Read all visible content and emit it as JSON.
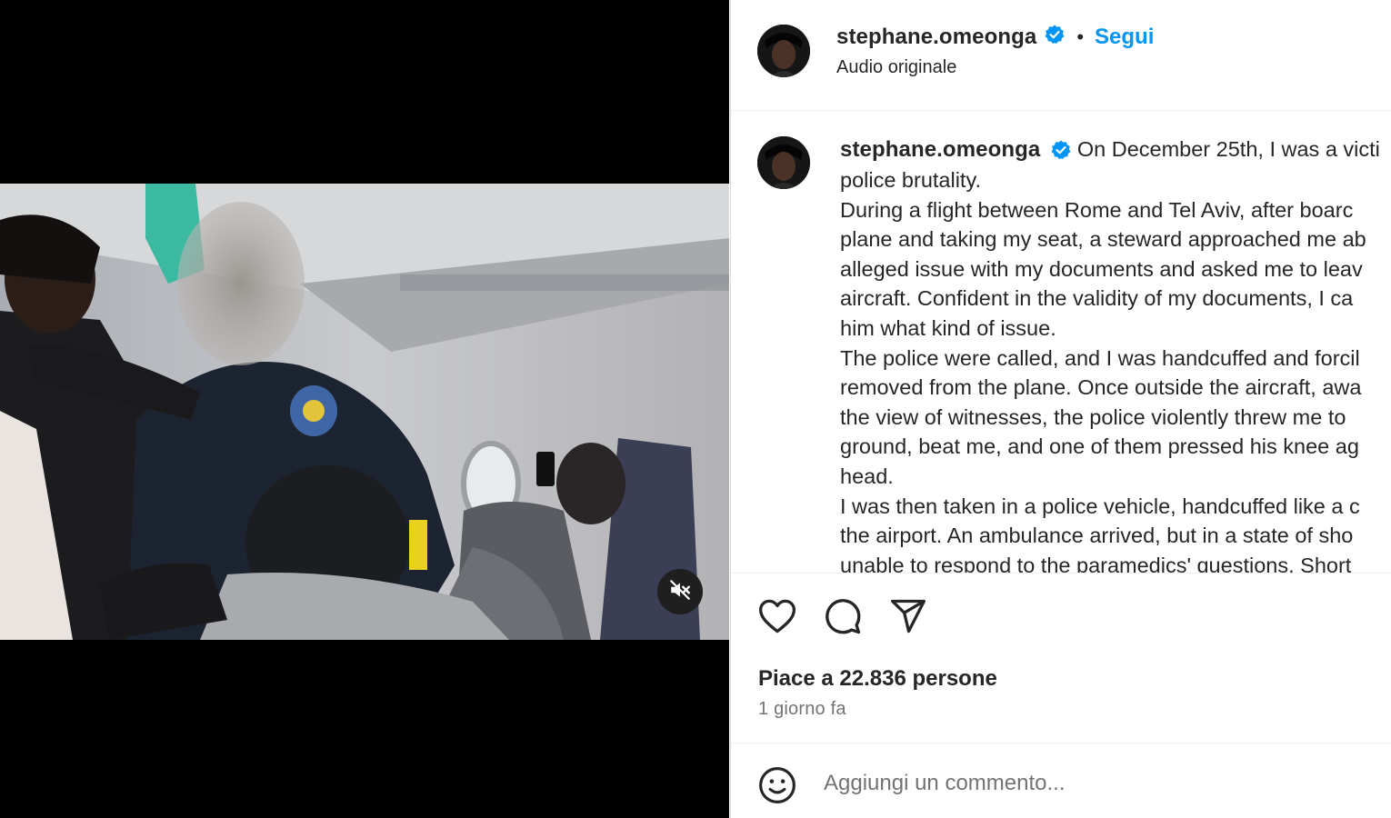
{
  "post": {
    "author": "stephane.omeonga",
    "verified": true,
    "follow_label": "Segui",
    "header_separator": "•",
    "audio_label": "Audio originale"
  },
  "caption": {
    "author": "stephane.omeonga",
    "lines": [
      "On December 25th, I was a victi",
      "police brutality.",
      "During a flight between Rome and Tel Aviv, after boarc",
      "plane and taking my seat, a steward approached me ab",
      "alleged issue with my documents and asked me to leav",
      "aircraft. Confident in the validity of my documents, I ca",
      "him what kind of issue.",
      "The police were called, and I was handcuffed and forcil",
      "removed from the plane. Once outside the aircraft, awa",
      "the view of witnesses, the police violently threw me to",
      "ground, beat me, and one of them pressed his knee ag",
      "head.",
      "I was then taken in a police vehicle, handcuffed like a c",
      "the airport. An ambulance arrived, but in a state of sho",
      "unable to respond to the paramedics' questions. Short"
    ]
  },
  "engagement": {
    "likes_text": "Piace a 22.836 persone",
    "time_text": "1 giorno fa"
  },
  "comment": {
    "placeholder": "Aggiungi un commento..."
  },
  "icons": {
    "like": "heart-icon",
    "comment": "comment-bubble-icon",
    "share": "paper-plane-icon",
    "emoji": "emoji-smiley-icon",
    "mute": "muted-speaker-icon",
    "verified": "verified-badge-icon"
  },
  "colors": {
    "accent": "#0095f6",
    "text": "#262626",
    "secondary": "#737373",
    "verified_badge": "#0095f6",
    "media_background": "#000000"
  }
}
